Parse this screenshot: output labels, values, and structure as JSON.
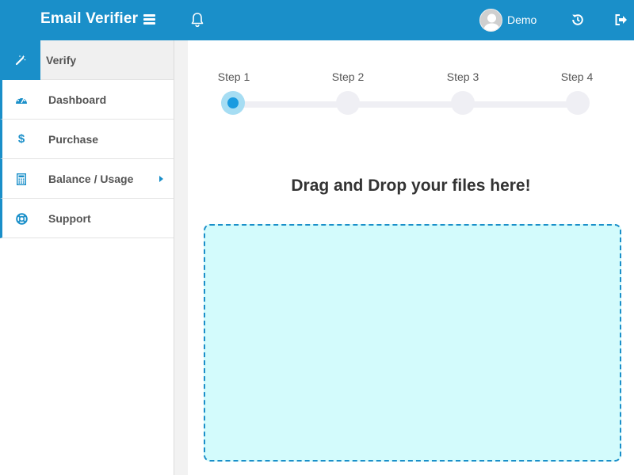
{
  "header": {
    "title": "Email Verifier",
    "user_name": "Demo",
    "accent_color": "#1a8fc9"
  },
  "sidebar": {
    "items": [
      {
        "label": "Verify",
        "icon": "magic-wand-icon",
        "active": true
      },
      {
        "label": "Dashboard",
        "icon": "dashboard-icon"
      },
      {
        "label": "Purchase",
        "icon": "dollar-icon"
      },
      {
        "label": "Balance / Usage",
        "icon": "calculator-icon",
        "has_submenu": true
      },
      {
        "label": "Support",
        "icon": "life-ring-icon"
      }
    ]
  },
  "wizard": {
    "steps": [
      {
        "label": "Step 1",
        "active": true
      },
      {
        "label": "Step 2",
        "active": false
      },
      {
        "label": "Step 3",
        "active": false
      },
      {
        "label": "Step 4",
        "active": false
      }
    ]
  },
  "upload": {
    "title": "Drag and Drop your files here!",
    "dropzone_color": "#d3fbfc"
  }
}
